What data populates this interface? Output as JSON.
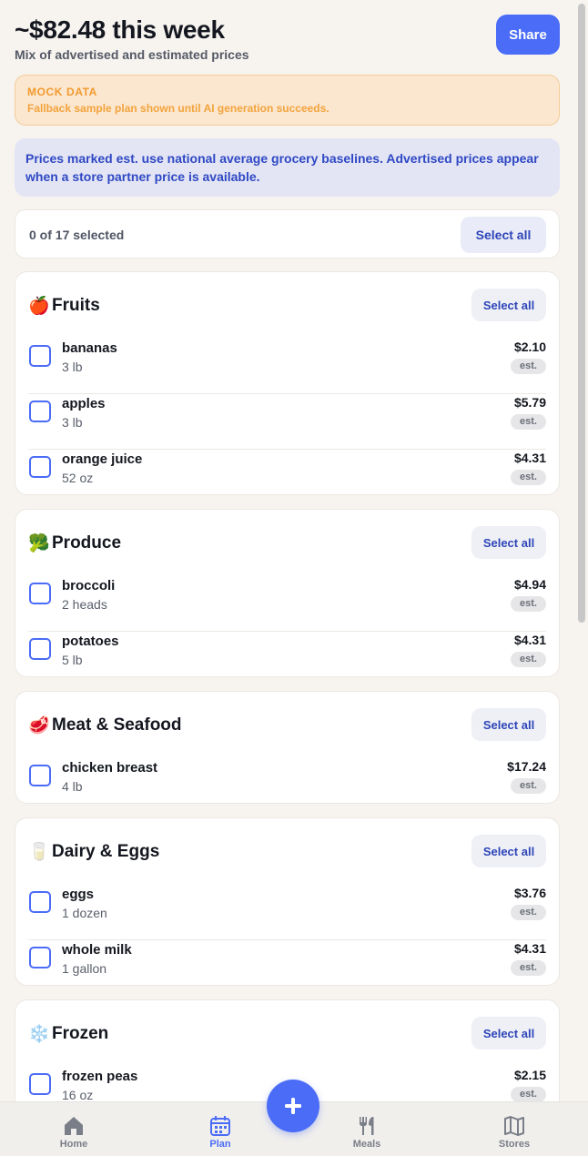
{
  "header": {
    "title": "~$82.48 this week",
    "subtitle": "Mix of advertised and estimated prices",
    "share_label": "Share"
  },
  "mock_banner": {
    "title": "MOCK DATA",
    "text": "Fallback sample plan shown until AI generation succeeds."
  },
  "info_banner": {
    "text": "Prices marked est. use national average grocery baselines. Advertised prices appear when a store partner price is available."
  },
  "selection": {
    "count_text": "0 of 17 selected",
    "select_all_label": "Select all"
  },
  "categories": [
    {
      "emoji": "🍎",
      "name": "Fruits",
      "select_all_label": "Select all",
      "items": [
        {
          "name": "bananas",
          "qty": "3 lb",
          "price": "$2.10",
          "badge": "est."
        },
        {
          "name": "apples",
          "qty": "3 lb",
          "price": "$5.79",
          "badge": "est."
        },
        {
          "name": "orange juice",
          "qty": "52 oz",
          "price": "$4.31",
          "badge": "est."
        }
      ]
    },
    {
      "emoji": "🥦",
      "name": "Produce",
      "select_all_label": "Select all",
      "items": [
        {
          "name": "broccoli",
          "qty": "2 heads",
          "price": "$4.94",
          "badge": "est."
        },
        {
          "name": "potatoes",
          "qty": "5 lb",
          "price": "$4.31",
          "badge": "est."
        }
      ]
    },
    {
      "emoji": "🥩",
      "name": "Meat & Seafood",
      "select_all_label": "Select all",
      "items": [
        {
          "name": "chicken breast",
          "qty": "4 lb",
          "price": "$17.24",
          "badge": "est."
        }
      ]
    },
    {
      "emoji": "🥛",
      "name": "Dairy & Eggs",
      "select_all_label": "Select all",
      "items": [
        {
          "name": "eggs",
          "qty": "1 dozen",
          "price": "$3.76",
          "badge": "est."
        },
        {
          "name": "whole milk",
          "qty": "1 gallon",
          "price": "$4.31",
          "badge": "est."
        }
      ]
    },
    {
      "emoji": "❄️",
      "name": "Frozen",
      "select_all_label": "Select all",
      "items": [
        {
          "name": "frozen peas",
          "qty": "16 oz",
          "price": "$2.15",
          "badge": "est."
        }
      ]
    }
  ],
  "nav": {
    "home": "Home",
    "plan": "Plan",
    "meals": "Meals",
    "stores": "Stores",
    "fab_icon": "plus-icon"
  },
  "colors": {
    "accent": "#4a6cf7",
    "mock_text": "#f29a2e",
    "info_text": "#2f48c4"
  }
}
